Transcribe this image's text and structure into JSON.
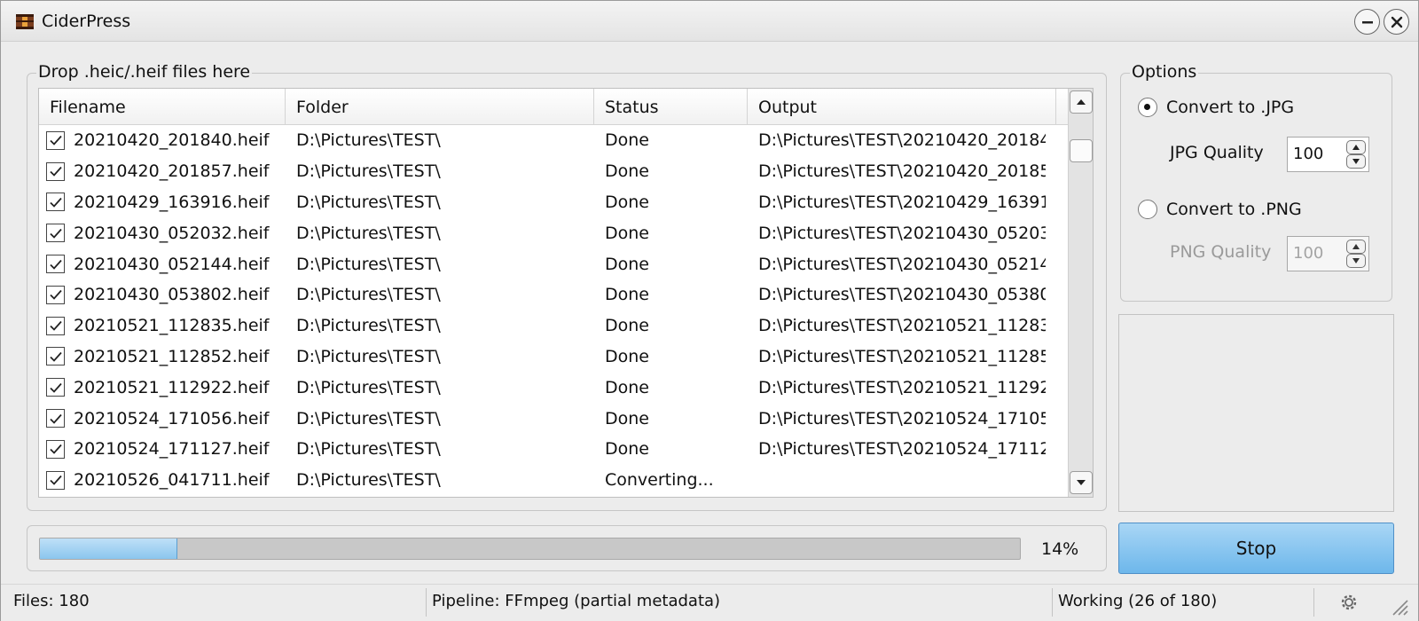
{
  "window": {
    "title": "CiderPress"
  },
  "drop_area": {
    "title": "Drop .heic/.heif files here"
  },
  "table": {
    "columns": [
      "Filename",
      "Folder",
      "Status",
      "Output"
    ],
    "rows": [
      {
        "checked": true,
        "filename": "20210420_201840.heif",
        "folder": "D:\\Pictures\\TEST\\",
        "status": "Done",
        "output": "D:\\Pictures\\TEST\\20210420_20184..."
      },
      {
        "checked": true,
        "filename": "20210420_201857.heif",
        "folder": "D:\\Pictures\\TEST\\",
        "status": "Done",
        "output": "D:\\Pictures\\TEST\\20210420_20185..."
      },
      {
        "checked": true,
        "filename": "20210429_163916.heif",
        "folder": "D:\\Pictures\\TEST\\",
        "status": "Done",
        "output": "D:\\Pictures\\TEST\\20210429_16391..."
      },
      {
        "checked": true,
        "filename": "20210430_052032.heif",
        "folder": "D:\\Pictures\\TEST\\",
        "status": "Done",
        "output": "D:\\Pictures\\TEST\\20210430_05203..."
      },
      {
        "checked": true,
        "filename": "20210430_052144.heif",
        "folder": "D:\\Pictures\\TEST\\",
        "status": "Done",
        "output": "D:\\Pictures\\TEST\\20210430_05214..."
      },
      {
        "checked": true,
        "filename": "20210430_053802.heif",
        "folder": "D:\\Pictures\\TEST\\",
        "status": "Done",
        "output": "D:\\Pictures\\TEST\\20210430_05380..."
      },
      {
        "checked": true,
        "filename": "20210521_112835.heif",
        "folder": "D:\\Pictures\\TEST\\",
        "status": "Done",
        "output": "D:\\Pictures\\TEST\\20210521_11283..."
      },
      {
        "checked": true,
        "filename": "20210521_112852.heif",
        "folder": "D:\\Pictures\\TEST\\",
        "status": "Done",
        "output": "D:\\Pictures\\TEST\\20210521_11285..."
      },
      {
        "checked": true,
        "filename": "20210521_112922.heif",
        "folder": "D:\\Pictures\\TEST\\",
        "status": "Done",
        "output": "D:\\Pictures\\TEST\\20210521_11292..."
      },
      {
        "checked": true,
        "filename": "20210524_171056.heif",
        "folder": "D:\\Pictures\\TEST\\",
        "status": "Done",
        "output": "D:\\Pictures\\TEST\\20210524_17105..."
      },
      {
        "checked": true,
        "filename": "20210524_171127.heif",
        "folder": "D:\\Pictures\\TEST\\",
        "status": "Done",
        "output": "D:\\Pictures\\TEST\\20210524_17112..."
      },
      {
        "checked": true,
        "filename": "20210526_041711.heif",
        "folder": "D:\\Pictures\\TEST\\",
        "status": "Converting...",
        "output": ""
      }
    ]
  },
  "options": {
    "title": "Options",
    "jpg_label": "Convert to .JPG",
    "jpg_selected": true,
    "jpg_quality_label": "JPG Quality",
    "jpg_quality": "100",
    "png_label": "Convert to .PNG",
    "png_selected": false,
    "png_quality_label": "PNG Quality",
    "png_quality": "100"
  },
  "progress": {
    "percent": 14,
    "label": "14%"
  },
  "actions": {
    "stop_label": "Stop"
  },
  "statusbar": {
    "files": "Files: 180",
    "pipeline": "Pipeline: FFmpeg (partial metadata)",
    "working": "Working (26 of 180)"
  },
  "colors": {
    "accent": "#7cc0ee",
    "progress_fill": "#a6d3f3",
    "window_bg": "#ececec"
  },
  "icons": {
    "app": "ciderpress-barrel-icon",
    "settings": "gear-icon",
    "resize": "resize-grip-icon"
  }
}
